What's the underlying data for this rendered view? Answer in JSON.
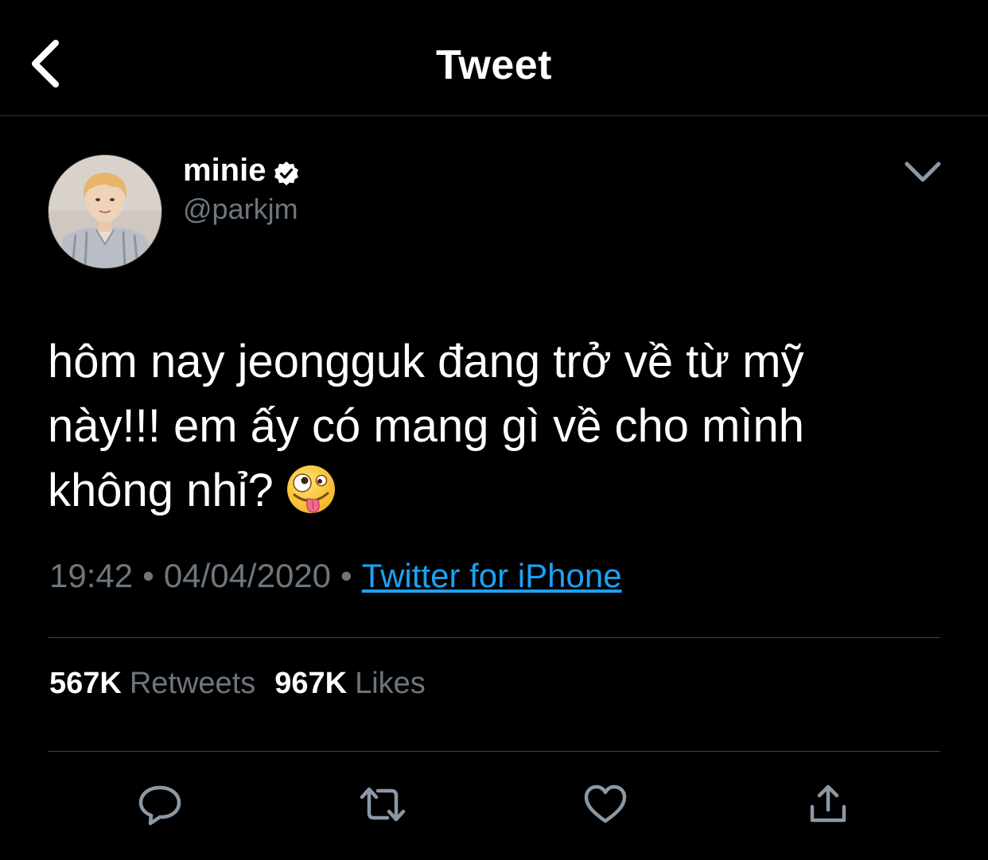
{
  "header": {
    "title": "Tweet",
    "back_icon": "chevron-left-icon"
  },
  "author": {
    "display_name": "minie",
    "handle": "@parkjm",
    "verified": true
  },
  "tweet": {
    "lines": [
      "hôm nay jeongguk đang trở về từ mỹ",
      "này!!! em ấy có mang gì về cho mình",
      "không nhỉ?"
    ],
    "emoji": "zany-face-emoji"
  },
  "meta": {
    "time": "19:42",
    "separator": "•",
    "date": "04/04/2020",
    "source": "Twitter for iPhone"
  },
  "stats": {
    "retweets_count": "567K",
    "retweets_label": "Retweets",
    "likes_count": "967K",
    "likes_label": "Likes"
  },
  "actions": [
    "reply-icon",
    "retweet-icon",
    "like-icon",
    "share-icon"
  ],
  "colors": {
    "background": "#000000",
    "text": "#ffffff",
    "secondary": "#6e767d",
    "link": "#1da1f2",
    "divider": "#38444d"
  }
}
